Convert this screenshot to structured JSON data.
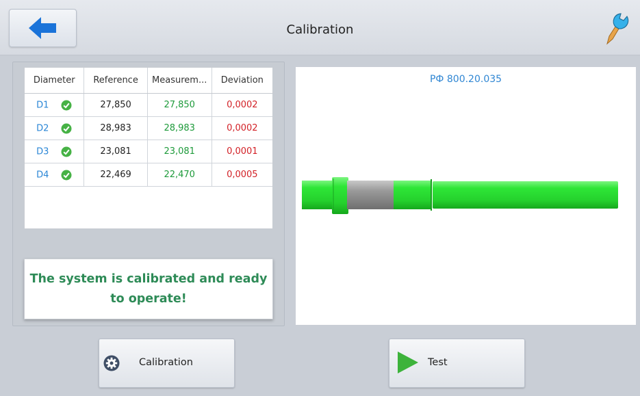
{
  "header": {
    "title": "Calibration",
    "back_icon": "arrow-left-icon",
    "tool_icon": "wrench-icon"
  },
  "table": {
    "columns": [
      "Diameter",
      "Reference",
      "Measurem...",
      "Deviation"
    ],
    "rows": [
      {
        "name": "D1",
        "status": "ok",
        "reference": "27,850",
        "measurement": "27,850",
        "deviation": "0,0002"
      },
      {
        "name": "D2",
        "status": "ok",
        "reference": "28,983",
        "measurement": "28,983",
        "deviation": "0,0002"
      },
      {
        "name": "D3",
        "status": "ok",
        "reference": "23,081",
        "measurement": "23,081",
        "deviation": "0,0001"
      },
      {
        "name": "D4",
        "status": "ok",
        "reference": "22,469",
        "measurement": "22,470",
        "deviation": "0,0005"
      }
    ]
  },
  "status": {
    "message": "The system is calibrated and ready to operate!"
  },
  "preview": {
    "part_code": "РФ 800.20.035"
  },
  "buttons": {
    "calibration_label": "Calibration",
    "calibration_icon": "gear-icon",
    "test_label": "Test",
    "test_icon": "play-icon"
  },
  "colors": {
    "accent_blue": "#1a73d9",
    "ok_green": "#1d9a3a",
    "deviation_red": "#d21f25",
    "status_green": "#2e8b57",
    "part_green": "#2ee637"
  }
}
